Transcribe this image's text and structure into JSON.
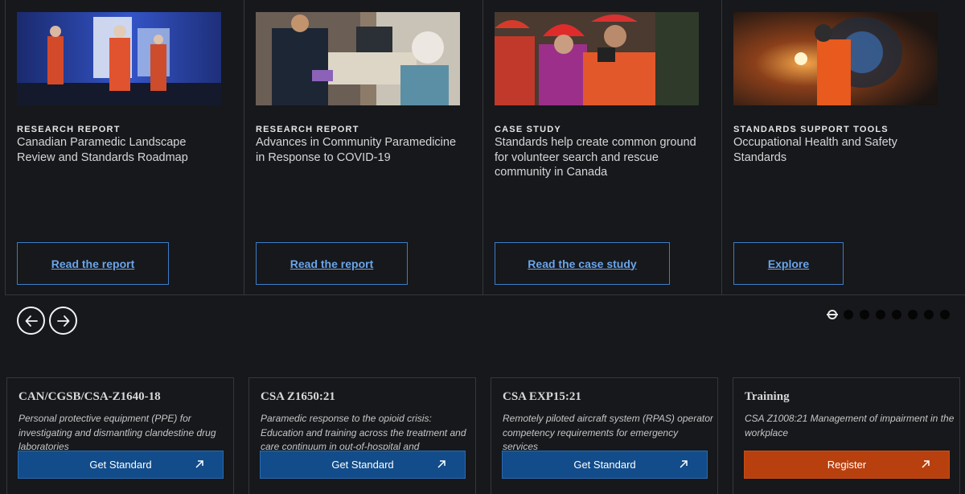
{
  "carousel": {
    "cards": [
      {
        "category": "Research Report",
        "title": "Canadian Paramedic Landscape Review and Standards Roadmap",
        "button": "Read the report",
        "image": "paramedics-at-ambulance-night-photo"
      },
      {
        "category": "Research Report",
        "title": "Advances in Community Paramedicine in Response to COVID-19",
        "button": "Read the report",
        "image": "paramedic-with-elderly-patient-photo"
      },
      {
        "category": "Case Study",
        "title": "Standards help create common ground for volunteer search and rescue community in Canada",
        "button": "Read the case study",
        "image": "search-and-rescue-team-photo"
      },
      {
        "category": "Standards Support Tools",
        "title": "Occupational Health and Safety Standards",
        "button": "Explore",
        "image": "welder-in-tunnel-photo"
      }
    ],
    "prev_icon": "arrow-left-icon",
    "next_icon": "arrow-right-icon",
    "dots": {
      "total": 8,
      "active": 1
    }
  },
  "standards": [
    {
      "title": "CAN/CGSB/CSA-Z1640-18",
      "description": "Personal protective equipment (PPE) for investigating and dismantling clandestine drug laboratories",
      "button": "Get Standard",
      "color": "#124c8a"
    },
    {
      "title": "CSA Z1650:21",
      "description": "Paramedic response to the opioid crisis: Education and training across the treatment and care continuum in out-of-hospital and",
      "button": "Get Standard",
      "color": "#124c8a"
    },
    {
      "title": "CSA EXP15:21",
      "description": "Remotely piloted aircraft system (RPAS) operator competency requirements for emergency services",
      "button": "Get Standard",
      "color": "#124c8a"
    },
    {
      "title": "Training",
      "description": "CSA Z1008:21 Management of impairment in the workplace",
      "button": "Register",
      "color": "#b8400e"
    }
  ],
  "external_icon": "external-link-arrow-icon"
}
